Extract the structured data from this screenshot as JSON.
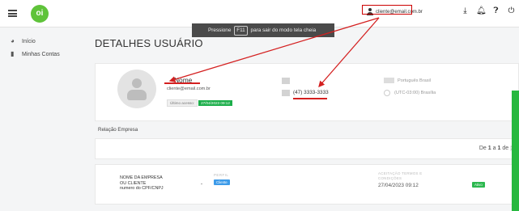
{
  "header": {
    "logo_text": "oi",
    "user_email": "cliente@email.com.br",
    "icons": [
      "menu-icon",
      "user-icon",
      "download-icon",
      "bell-icon",
      "help-icon",
      "power-icon"
    ]
  },
  "fullscreen_toast": {
    "before": "Pressione",
    "key": "F11",
    "after": "para sair do modo tela cheia"
  },
  "sidebar": {
    "items": [
      {
        "label": "Início",
        "icon": "dashboard-icon"
      },
      {
        "label": "Minhas Contas",
        "icon": "file-icon"
      }
    ]
  },
  "main": {
    "title": "DETALHES USUÁRIO",
    "user": {
      "name": "Nome",
      "email": "cliente@email.com.br",
      "last_access_label": "Último acesso:",
      "last_access_value": "27/04/2023 09:12",
      "phone": "(47) 3333-3333",
      "language": "Português Brasil",
      "timezone": "(UTC-03:00) Brasília"
    },
    "relation": {
      "title": "Relação Empresa",
      "pager": {
        "prefix": "De",
        "page": "1",
        "sep": "a",
        "total": "1",
        "sep2": "de",
        "current": "1"
      },
      "rows": [
        {
          "company_line1": "NOME DA EMPRESA",
          "company_line2": "OU CLIENTE",
          "company_line3": "numero do CPF/CNPJ",
          "profile_label": "PERFIL",
          "profile_value": "Cliente",
          "terms_label_1": "ACEITAÇÃO TERMOS E",
          "terms_label_2": "CONDIÇÕES",
          "terms_date": "27/04/2023 09:12",
          "status": "Ativo"
        }
      ]
    }
  },
  "colors": {
    "brand_green": "#5fc33a",
    "annotation_red": "#d42020",
    "success_green": "#1cae4a",
    "profile_blue": "#3d9be9"
  }
}
